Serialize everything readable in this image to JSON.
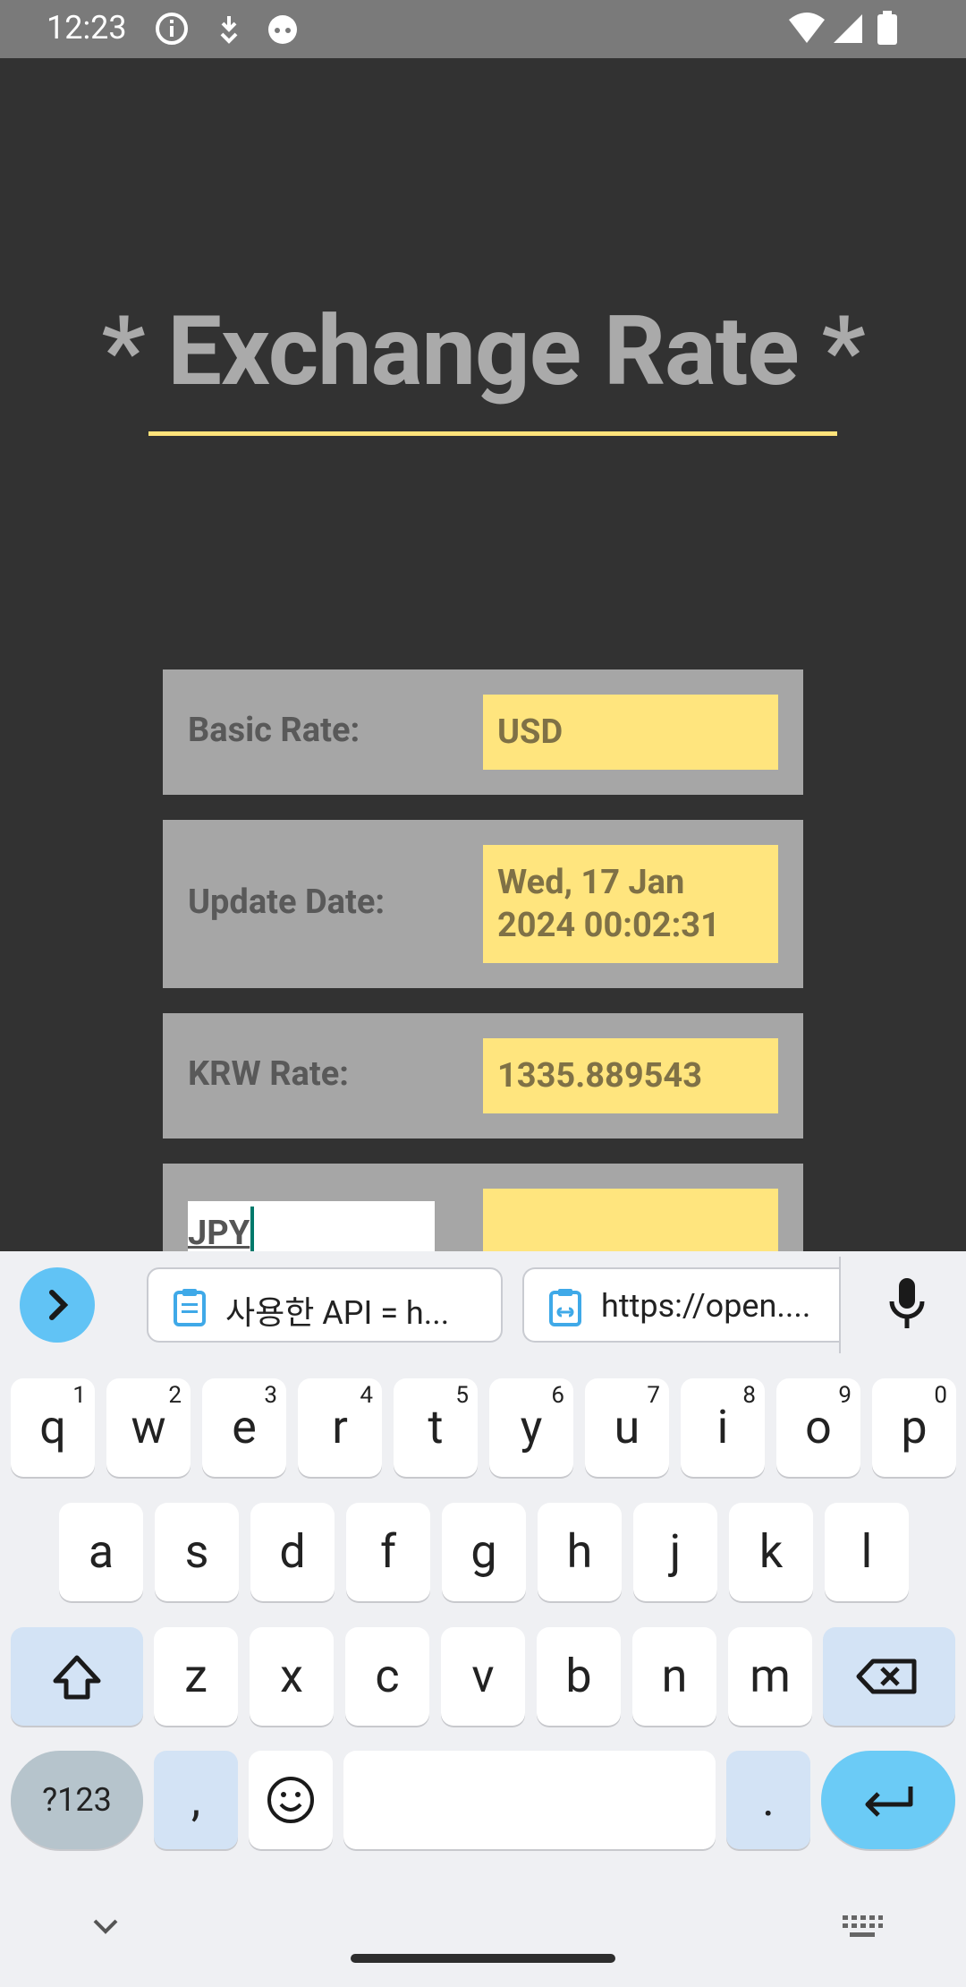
{
  "status_bar": {
    "time": "12:23"
  },
  "app": {
    "title": "* Exchange Rate *",
    "rows": [
      {
        "label": "Basic Rate:",
        "value": "USD"
      },
      {
        "label": "Update Date:",
        "value_line1": "Wed, 17 Jan",
        "value_line2": "2024 00:02:31"
      },
      {
        "label": "KRW Rate:",
        "value": "1335.889543"
      }
    ],
    "currency_input": {
      "value": "JPY"
    },
    "currency_result": ""
  },
  "keyboard": {
    "clip_chips": [
      {
        "text": "사용한 API = h..."
      },
      {
        "text": "https://open...."
      }
    ],
    "row1": [
      {
        "k": "q",
        "h": "1"
      },
      {
        "k": "w",
        "h": "2"
      },
      {
        "k": "e",
        "h": "3"
      },
      {
        "k": "r",
        "h": "4"
      },
      {
        "k": "t",
        "h": "5"
      },
      {
        "k": "y",
        "h": "6"
      },
      {
        "k": "u",
        "h": "7"
      },
      {
        "k": "i",
        "h": "8"
      },
      {
        "k": "o",
        "h": "9"
      },
      {
        "k": "p",
        "h": "0"
      }
    ],
    "row2": [
      "a",
      "s",
      "d",
      "f",
      "g",
      "h",
      "j",
      "k",
      "l"
    ],
    "row3": [
      "z",
      "x",
      "c",
      "v",
      "b",
      "n",
      "m"
    ],
    "symbols_label": "?123",
    "comma": ",",
    "period": "."
  }
}
